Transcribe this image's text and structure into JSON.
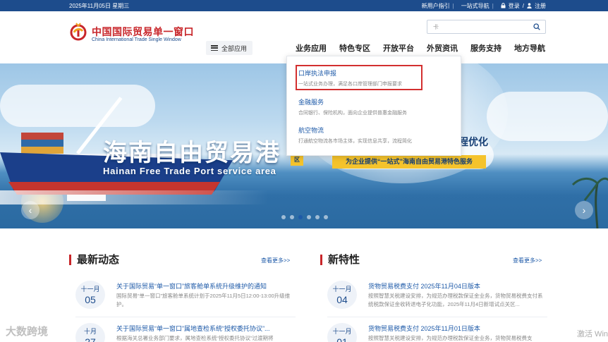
{
  "topbar": {
    "date": "2025年11月05日 星期三",
    "new_user_guide": "新用户指引",
    "one_stop_nav": "一站式导航",
    "login": "登录",
    "separator": "/",
    "register": "注册"
  },
  "header": {
    "brand_cn": "中国国际贸易单一窗口",
    "brand_en": "China International Trade Single Window",
    "all_apps": "全部应用",
    "search_value": "卡"
  },
  "nav": {
    "items": [
      "业务应用",
      "特色专区",
      "开放平台",
      "外贸资讯",
      "服务支持",
      "地方导航"
    ]
  },
  "dropdown": {
    "items": [
      {
        "title": "口岸执法申报",
        "desc": "一站式业务办理，满足各口岸管理部门申报要求"
      },
      {
        "title": "金融服务",
        "desc": "合同银行、保险机构，面向企业提供普惠金融服务"
      },
      {
        "title": "航空物流",
        "desc": "打通航空物流各市场主体，实现信息共享，流程简化"
      }
    ]
  },
  "banner": {
    "title_cn": "海南自由贸易港",
    "title_en": "Hainan Free Trade Port service area",
    "tagline_tail": "程优化",
    "badge": "区",
    "cta": "为企业提供“一站式”海南自由贸易港特色服务",
    "prev_arrow": "‹",
    "next_arrow": "›",
    "slide_count": 6,
    "active_slide": 2
  },
  "latest": {
    "title": "最新动态",
    "more": "查看更多>>",
    "items": [
      {
        "month": "十一月",
        "day": "05",
        "title": "关于国际贸易“单一窗口”旅客舱单系统升级维护的通知",
        "desc": "国际贸易“单一窗口”旅客舱单系统计划于2025年11月5日12:00-13:00升级维护。"
      },
      {
        "month": "十月",
        "day": "27",
        "title": "关于国际贸易“单一窗口”属地查检系统“授权委托协议”...",
        "desc": "根据海关总署业务部门要求，属地查检系统“授权委托协议”过渡期将"
      }
    ]
  },
  "features": {
    "title": "新特性",
    "more": "查看更多>>",
    "items": [
      {
        "month": "十一月",
        "day": "04",
        "title": "货物贸易税费支付 2025年11月04日版本",
        "desc": "按照智慧关税建设安排，为规范办理税款保证金业务，货物贸易税费支付系统税款保证金收转退电子化功能，2025年11月4日新增试点关区..."
      },
      {
        "month": "十一月",
        "day": "01",
        "title": "货物贸易税费支付 2025年11月01日版本",
        "desc": "按照智慧关税建设安排，为规范办理税款保证金业务，货物贸易税费支"
      }
    ]
  },
  "watermarks": {
    "left": "大数跨境",
    "right": "激活 Win"
  }
}
